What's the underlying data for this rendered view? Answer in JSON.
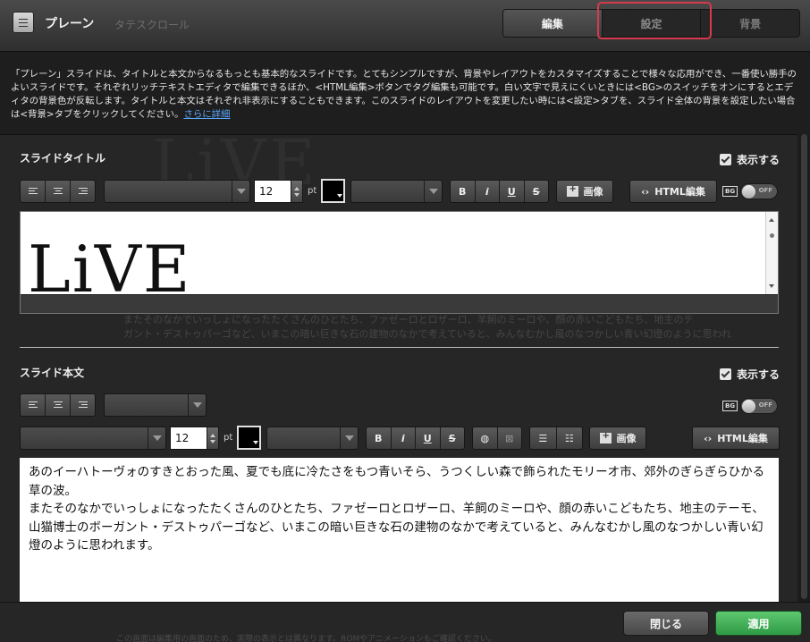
{
  "header": {
    "title": "プレーン",
    "ghost_title": "タテスクロール",
    "tabs": [
      {
        "label": "編集",
        "active": true
      },
      {
        "label": "設定",
        "active": false
      },
      {
        "label": "背景",
        "active": false
      }
    ],
    "highlight_color": "#d63a4c"
  },
  "description": {
    "text": "「プレーン」スライドは、タイトルと本文からなるもっとも基本的なスライドです。とてもシンプルですが、背景やレイアウトをカスタマイズすることで様々な応用ができ、一番使い勝手のよいスライドです。それぞれリッチテキストエディタで編集できるほか、<HTML編集>ボタンでタグ編集も可能です。白い文字で見えにくいときには<BG>のスイッチをオンにするとエディタの背景色が反転します。タイトルと本文はそれぞれ非表示にすることもできます。このスライドのレイアウトを変更したい時には<設定>タブを、スライド全体の背景を設定したい場合は<背景>タブをクリックしてください。",
    "link": "さらに詳細"
  },
  "background": {
    "word": "LiVE",
    "line1": "またそのなかでいっしょになったたくさんのひとたち、ファゼーロとロザーロ、羊飼のミーロや、顔の赤いこどもたち、地主のテ",
    "line2": "ガント・デストゥパーゴなど、いまこの暗い巨きな石の建物のなかで考えていると、みんなむかし風のなつかしい青い幻燈のように思われ"
  },
  "title_section": {
    "label": "スライドタイトル",
    "show_label": "表示する",
    "font_size": "12",
    "unit": "pt",
    "bold": "B",
    "italic": "i",
    "underline": "U",
    "strike": "S",
    "image_label": "画像",
    "html_label": "HTML編集",
    "bg_badge": "BG",
    "toggle_off": "OFF",
    "content": "LiVE"
  },
  "body_section": {
    "label": "スライド本文",
    "show_label": "表示する",
    "font_size": "12",
    "unit": "pt",
    "bold": "B",
    "italic": "i",
    "underline": "U",
    "strike": "S",
    "image_label": "画像",
    "html_label": "HTML編集",
    "bg_badge": "BG",
    "toggle_off": "OFF",
    "content_p1": "あのイーハトーヴォのすきとおった風、夏でも底に冷たさをもつ青いそら、うつくしい森で飾られたモリーオ市、郊外のぎらぎらひかる草の波。",
    "content_p2": "またそのなかでいっしょになったたくさんのひとたち、ファゼーロとロザーロ、羊飼のミーロや、顔の赤いこどもたち、地主のテーモ、山猫博士のボーガント・デストゥパーゴなど、いまこの暗い巨きな石の建物のなかで考えていると、みんなむかし風のなつかしい青い幻燈のように思われます。"
  },
  "footer": {
    "ghost": "この画面は編集用の画面のため、実際の表示とは異なります。ROMやアニメーションもご確認ください。",
    "close_label": "閉じる",
    "apply_label": "適用",
    "apply_color": "#3aa852"
  }
}
